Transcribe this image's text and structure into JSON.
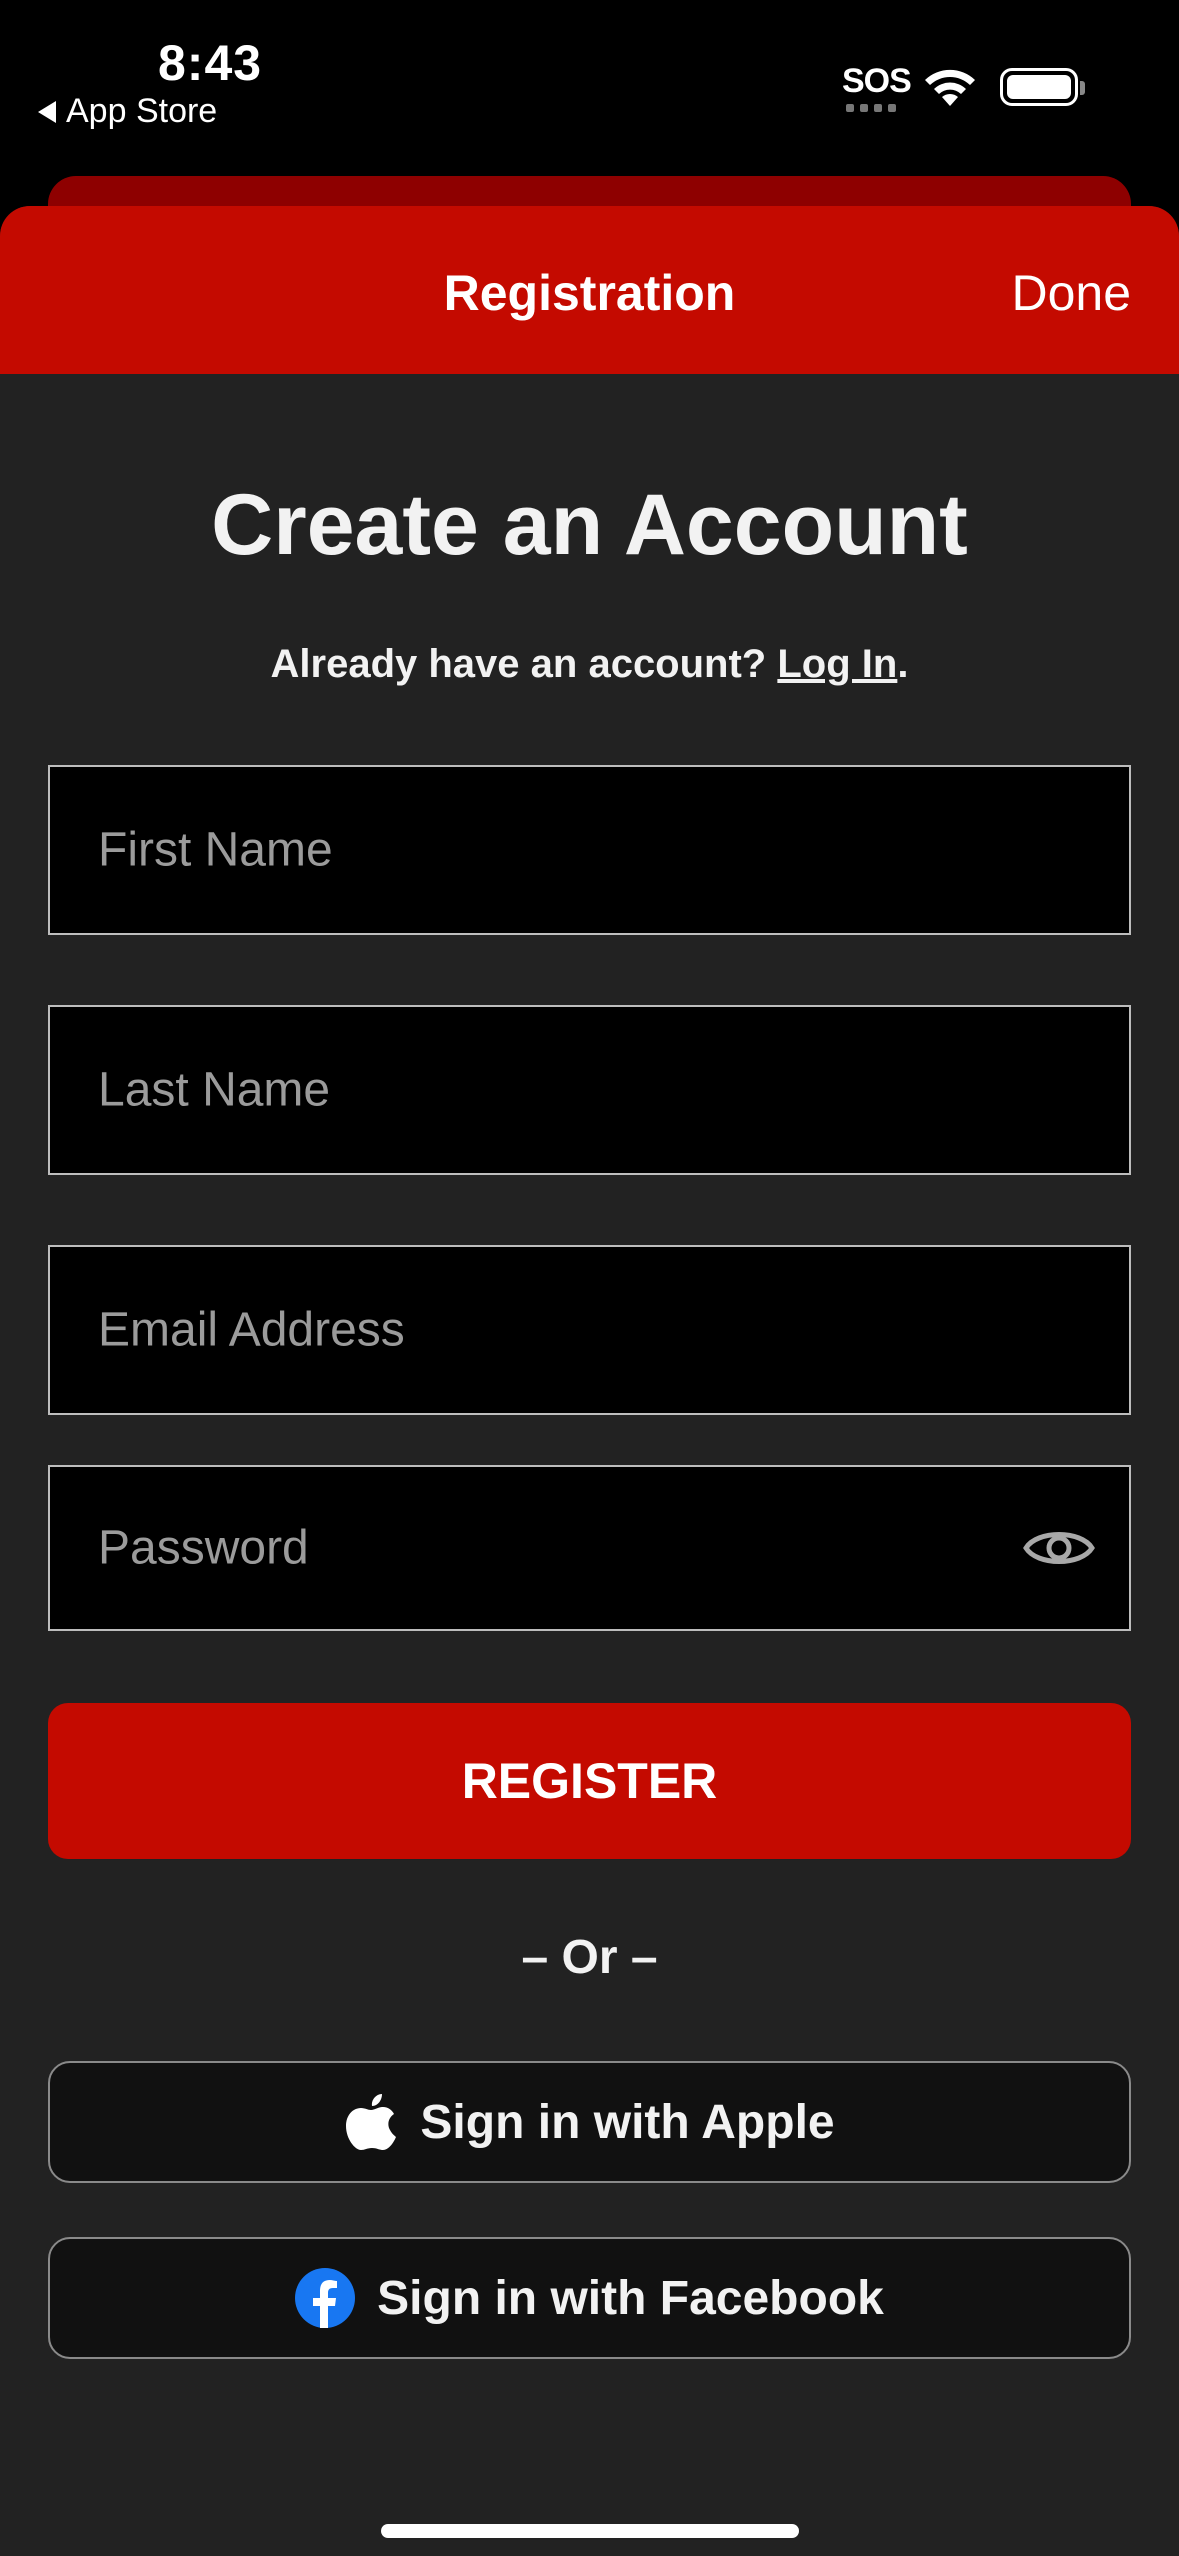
{
  "status_bar": {
    "time": "8:43",
    "back_app": "App Store",
    "sos": "SOS"
  },
  "nav": {
    "title": "Registration",
    "done_label": "Done"
  },
  "page": {
    "heading": "Create an Account",
    "login_prompt": "Already have an account?",
    "login_link": "Log In",
    "login_suffix": "."
  },
  "form": {
    "first_name_placeholder": "First Name",
    "last_name_placeholder": "Last Name",
    "email_placeholder": "Email Address",
    "password_placeholder": "Password",
    "register_label": "REGISTER",
    "divider": "– Or –"
  },
  "social": {
    "apple_label": "Sign in with Apple",
    "facebook_label": "Sign in with Facebook"
  },
  "colors": {
    "accent": "#c40a00",
    "sheet_background": "#222222",
    "field_background": "#000000",
    "facebook_blue": "#1877f2"
  },
  "icons": [
    "back-triangle-icon",
    "wifi-icon",
    "battery-icon",
    "eye-icon",
    "apple-icon",
    "facebook-icon"
  ]
}
